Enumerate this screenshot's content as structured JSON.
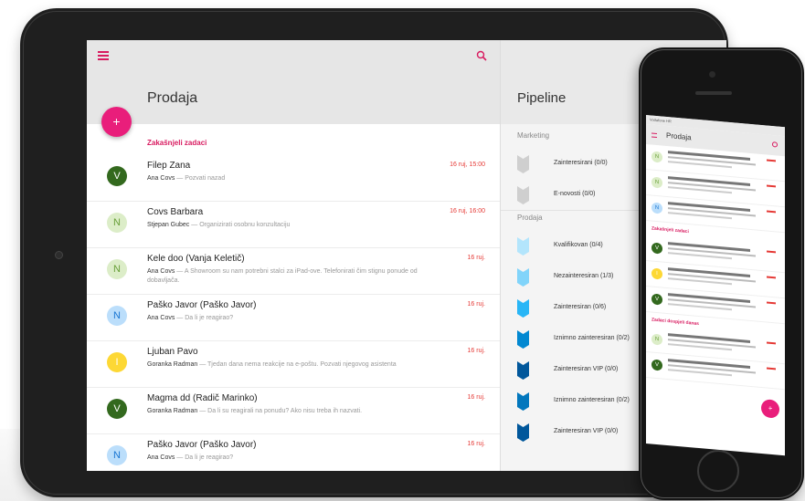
{
  "app": {
    "title": "Prodaja",
    "fab_label": "+",
    "overdue_label": "Zakašnjeli zadaci"
  },
  "tasks": [
    {
      "initial": "V",
      "color": "#33691e",
      "text_color": "#ffffff",
      "name": "Filep Zana",
      "person": "Ana Covs",
      "note": "Pozvati nazad",
      "date": "16 ruj, 15:00"
    },
    {
      "initial": "N",
      "color": "#dcedc8",
      "text_color": "#689f38",
      "name": "Covs Barbara",
      "person": "Stjepan Gubec",
      "note": "Organizirati osobnu konzultaciju",
      "date": "16 ruj, 16:00"
    },
    {
      "initial": "N",
      "color": "#dcedc8",
      "text_color": "#689f38",
      "name": "Kele doo (Vanja Keletič)",
      "person": "Ana Covs",
      "note": "A Showroom su nam potrebni stalci za iPad-ove. Telefonirati čim stignu ponude od dobavljača.",
      "date": "16 ruj."
    },
    {
      "initial": "N",
      "color": "#bbdefb",
      "text_color": "#1976d2",
      "name": "Paško Javor (Paško Javor)",
      "person": "Ana Covs",
      "note": "Da li je reagirao?",
      "date": "16 ruj."
    },
    {
      "initial": "I",
      "color": "#fdd835",
      "text_color": "#ffffff",
      "name": "Ljuban Pavo",
      "person": "Goranka Radman",
      "note": "Tjedan dana nema reakcije na e-poštu. Pozvati njegovog asistenta",
      "date": "16 ruj."
    },
    {
      "initial": "V",
      "color": "#33691e",
      "text_color": "#ffffff",
      "name": "Magma dd (Radič Marinko)",
      "person": "Goranka Radman",
      "note": "Da li su reagirali na ponudu? Ako nisu treba ih nazvati.",
      "date": "16 ruj."
    },
    {
      "initial": "N",
      "color": "#bbdefb",
      "text_color": "#1976d2",
      "name": "Paško Javor (Paško Javor)",
      "person": "Ana Covs",
      "note": "Da li je reagirao?",
      "date": "16 ruj."
    }
  ],
  "pipeline": {
    "title": "Pipeline",
    "groups": [
      {
        "label": "Marketing",
        "stages": [
          {
            "label": "Zainteresirani (0/0)",
            "color": "#cfcfcf"
          },
          {
            "label": "E-novosti (0/0)",
            "color": "#cfcfcf"
          }
        ]
      },
      {
        "label": "Prodaja",
        "stages": [
          {
            "label": "Kvalifikovan (0/4)",
            "color": "#b3e5fc"
          },
          {
            "label": "Nezainteresiran (1/3)",
            "color": "#81d4fa"
          },
          {
            "label": "Zainteresiran (0/6)",
            "color": "#29b6f6"
          },
          {
            "label": "Iznimno zainteresiran (0/2)",
            "color": "#0288d1"
          },
          {
            "label": "Zainteresiran VIP (0/0)",
            "color": "#01579b"
          },
          {
            "label": "Iznimno zainteresiran (0/2)",
            "color": "#0277bd"
          },
          {
            "label": "Zainteresiran VIP (0/0)",
            "color": "#01579b"
          }
        ]
      }
    ]
  },
  "phone": {
    "status": "Vodafone HR",
    "title": "Prodaja",
    "section1": "Zakašnjeli zadaci",
    "section2": "Zadaci dospjeli danas"
  },
  "colors": {
    "accent": "#e91e7b",
    "date": "#e53935"
  }
}
